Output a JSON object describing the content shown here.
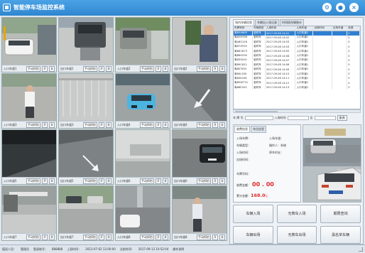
{
  "app": {
    "title": "智能停车场监控系统"
  },
  "cameras": [
    {
      "label": "入口车道1",
      "capture": "手动抓拍",
      "b1": "开",
      "b2": "关"
    },
    {
      "label": "出口车道1",
      "capture": "手动抓拍",
      "b1": "开",
      "b2": "关"
    },
    {
      "label": "入口车道2",
      "capture": "手动抓拍",
      "b1": "开",
      "b2": "关"
    },
    {
      "label": "出口车道2",
      "capture": "手动抓拍",
      "b1": "开",
      "b2": "关"
    },
    {
      "label": "入口车道3",
      "capture": "手动抓拍",
      "b1": "开",
      "b2": "关"
    },
    {
      "label": "出口车道3",
      "capture": "手动抓拍",
      "b1": "开",
      "b2": "关"
    },
    {
      "label": "入口车道4",
      "capture": "手动抓拍",
      "b1": "开",
      "b2": "关"
    },
    {
      "label": "出口车道4",
      "capture": "手动抓拍",
      "b1": "开",
      "b2": "关"
    },
    {
      "label": "入口车道5",
      "capture": "手动抓拍",
      "b1": "开",
      "b2": "关"
    },
    {
      "label": "出口车道5",
      "capture": "手动抓拍",
      "b1": "开",
      "b2": "关"
    },
    {
      "label": "入口车道6",
      "capture": "手动抓拍",
      "b1": "开",
      "b2": "关"
    },
    {
      "label": "出口车道6",
      "capture": "手动抓拍",
      "b1": "开",
      "b2": "关"
    },
    {
      "label": "入口车道7",
      "capture": "手动抓拍",
      "b1": "开",
      "b2": "关"
    },
    {
      "label": "出口车道7",
      "capture": "手动抓拍",
      "b1": "开",
      "b2": "关"
    },
    {
      "label": "入口车道8",
      "capture": "手动抓拍",
      "b1": "开",
      "b2": "关"
    },
    {
      "label": "出口车道8",
      "capture": "手动抓拍",
      "b1": "开",
      "b2": "关"
    }
  ],
  "records": {
    "tabs": [
      "场内车辆信息",
      "车辆出入场记录",
      "时间段车辆统计"
    ],
    "columns": [
      "车牌号码",
      "车辆类型",
      "入场时间",
      "入场车道",
      "出场时间",
      "出场车道",
      "收费"
    ],
    "rows": [
      [
        "粤B5A6K8",
        "临时车",
        "2017-09-08 14:01",
        "入口车道1",
        "",
        "",
        "0"
      ],
      [
        "粤B2M556",
        "临时车",
        "2017-09-08 14:02",
        "入口车道1",
        "",
        "",
        "0"
      ],
      [
        "粤A8G126",
        "临时车",
        "2017-09-08 14:03",
        "入口车道1",
        "",
        "",
        "0"
      ],
      [
        "粤B7Z919",
        "临时车",
        "2017-09-08 14:03",
        "入口车道1",
        "",
        "",
        "0"
      ],
      [
        "粤B81N73",
        "临时车",
        "2017-09-08 14:05",
        "入口车道1",
        "",
        "",
        "0"
      ],
      [
        "粤B6H290",
        "临时车",
        "2017-09-08 14:06",
        "入口车道1",
        "",
        "",
        "0"
      ],
      [
        "粤B3Q541",
        "临时车",
        "2017-09-08 14:07",
        "入口车道1",
        "",
        "",
        "0"
      ],
      [
        "粤B9C622",
        "临时车",
        "2017-09-08 14:08",
        "入口车道1",
        "",
        "",
        "0"
      ],
      [
        "粤B0T815",
        "临时车",
        "2017-09-08 14:09",
        "入口车道1",
        "",
        "",
        "0"
      ],
      [
        "粤B4L330",
        "临时车",
        "2017-09-08 14:10",
        "入口车道1",
        "",
        "",
        "0"
      ],
      [
        "粤B3K106",
        "临时车",
        "2017-09-08 14:11",
        "入口车道1",
        "",
        "",
        "0"
      ],
      [
        "粤B5W774",
        "临时车",
        "2017-09-08 14:12",
        "入口车道1",
        "",
        "",
        "0"
      ],
      [
        "粤B8E203",
        "临时车",
        "2017-09-08 14:13",
        "入口车道1",
        "",
        "",
        "0"
      ]
    ],
    "search": {
      "plate_label": "车 牌 号",
      "time_label": "入场时间",
      "to_label": "至",
      "query_label": "查询"
    }
  },
  "info": {
    "tabs": [
      "收费信息",
      "车位信息"
    ],
    "plate_label": "入场车牌：",
    "in_lane_label": "入场车道：",
    "vehicle_type_label": "车辆类型：",
    "in_time_label": "入场时间：",
    "out_time_label": "出场时间：",
    "duration_label": "停车时长：",
    "plate_no_label": "车牌号码：",
    "operator_label": "操作人：",
    "operator_value": "系统",
    "fee_label": "收费金额：",
    "fee_value": "00 . 00",
    "total_label": "累计金额：",
    "total_value": "168.0",
    "total_unit": "元"
  },
  "actions": [
    "车辆入场",
    "无牌车入场",
    "期限查询",
    "车辆出场",
    "无牌车出场",
    "黑名单车辆"
  ],
  "status": {
    "operator_label": "值班人员：",
    "operator_value": "管理员",
    "account_label": "登录账号：",
    "account_value": "888888",
    "login_time_label": "上班时间：",
    "login_time_value": "2013-07-02 12:00:00",
    "current_time_label": "当前时间：",
    "current_time_value": "2017-09-13 10:52:04",
    "version_label": "操作说明"
  },
  "colors": {
    "titlebar": "#2f86cf",
    "selected_row": "#2f7fd0",
    "fee": "#e02a2a"
  }
}
